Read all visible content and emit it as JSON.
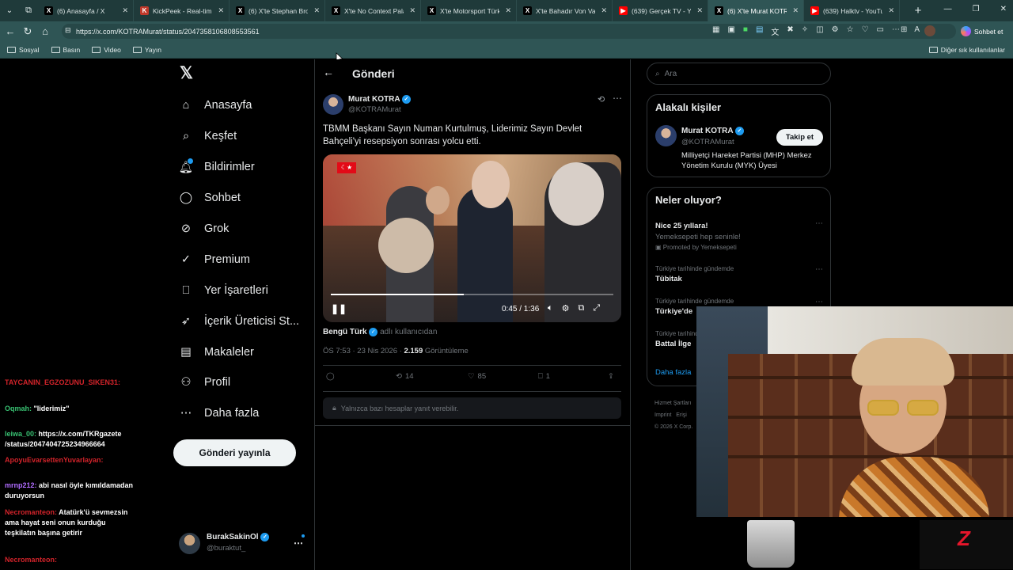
{
  "browser": {
    "tabs": [
      {
        "title": "(6) Anasayfa / X",
        "icon": "x-icon",
        "color": "#000000",
        "glyph": "X"
      },
      {
        "title": "KickPeek - Real-time UI",
        "icon": "kickpeek-icon",
        "color": "#c0392b",
        "glyph": "K"
      },
      {
        "title": "(6) X'te Stephan Brock",
        "icon": "x-icon",
        "color": "#000000",
        "glyph": "X"
      },
      {
        "title": "X'te No Context Pala: \"",
        "icon": "x-icon",
        "color": "#000000",
        "glyph": "X"
      },
      {
        "title": "X'te Motorsport Türkiye",
        "icon": "x-icon",
        "color": "#000000",
        "glyph": "X"
      },
      {
        "title": "X'te Bahadır Von Vanlı",
        "icon": "x-icon",
        "color": "#000000",
        "glyph": "X"
      },
      {
        "title": "(639) Gerçek TV - YouT",
        "icon": "youtube-icon",
        "color": "#ff0000",
        "glyph": "▶"
      },
      {
        "title": "(6) X'te Murat KOTR",
        "icon": "x-icon",
        "color": "#000000",
        "glyph": "X",
        "active": true
      },
      {
        "title": "(639) Halktv - YouTube",
        "icon": "youtube-icon",
        "color": "#ff0000",
        "glyph": "▶"
      }
    ],
    "url": "https://x.com/KOTRAMurat/status/2047358106808553561",
    "copilot_label": "Sohbet et",
    "bookmarks": [
      "Sosyal",
      "Basın",
      "Video",
      "Yayın"
    ],
    "other_bookmarks": "Diğer sık kullanılanlar"
  },
  "sidebar": {
    "items": [
      {
        "label": "Anasayfa",
        "icon": "home-icon"
      },
      {
        "label": "Keşfet",
        "icon": "search-icon"
      },
      {
        "label": "Bildirimler",
        "icon": "bell-icon"
      },
      {
        "label": "Sohbet",
        "icon": "chat-icon"
      },
      {
        "label": "Grok",
        "icon": "grok-icon"
      },
      {
        "label": "Premium",
        "icon": "premium-icon"
      },
      {
        "label": "Yer İşaretleri",
        "icon": "bookmark-icon"
      },
      {
        "label": "İçerik Üreticisi St...",
        "icon": "rocket-icon"
      },
      {
        "label": "Makaleler",
        "icon": "article-icon"
      },
      {
        "label": "Profil",
        "icon": "person-icon"
      },
      {
        "label": "Daha fazla",
        "icon": "more-circle-icon"
      }
    ],
    "post_button": "Gönderi yayınla",
    "account": {
      "name": "BurakSakinOl",
      "handle": "@buraktut_"
    }
  },
  "post": {
    "header_title": "Gönderi",
    "author_name": "Murat KOTRA",
    "author_handle": "@KOTRAMurat",
    "text": "TBMM Başkanı Sayın Numan Kurtulmuş, Liderimiz Sayın Devlet Bahçeli'yi resepsiyon sonrası yolcu etti.",
    "video_time": "0:45 / 1:36",
    "video_progress": 0.47,
    "source_name": "Bengü Türk",
    "source_suffix": "adlı kullanıcıdan",
    "timestamp": "ÖS 7:53 · 23 Nis 2026 ·",
    "views": "2.159",
    "views_label": "Görüntüleme",
    "retweets": "14",
    "likes": "85",
    "bookmarks": "1",
    "reply_restriction": "Yalnızca bazı hesaplar yanıt verebilir."
  },
  "right": {
    "search_placeholder": "Ara",
    "related_title": "Alakalı kişiler",
    "related": {
      "name": "Murat KOTRA",
      "handle": "@KOTRAMurat",
      "follow": "Takip et",
      "bio": "Milliyetçi Hareket Partisi (MHP) Merkez Yönetim Kurulu (MYK) Üyesi"
    },
    "trends_title": "Neler oluyor?",
    "trends": [
      {
        "title": "Nice 25 yıllara!",
        "sub": "Yemeksepeti hep seninle!",
        "promo": "Promoted by Yemeksepeti"
      },
      {
        "context": "Türkiye tarihinde gündemde",
        "title": "Tübitak"
      },
      {
        "context": "Türkiye tarihinde gündemde",
        "title": "Türkiye'de"
      },
      {
        "context": "Türkiye tarihinde gündemde",
        "title": "Battal İlge"
      }
    ],
    "more": "Daha fazla",
    "footer": [
      "Hizmet Şartları",
      "Imprint",
      "Erişi",
      "© 2026 X Corp."
    ]
  },
  "chat": [
    {
      "name": "TAYCANIN_EGZOZUNU_SIKEN31:",
      "name_color": "red",
      "msg": ""
    },
    {
      "name": "Oqmah:",
      "name_color": "green",
      "msg": " \"liderimiz\""
    },
    {
      "name": "leiwa_00:",
      "name_color": "green",
      "msg": " https://x.com/TKRgazete /status/2047404725234966664"
    },
    {
      "name": "ApoyuEvarsettenYuvarlayan:",
      "name_color": "red",
      "msg": ""
    },
    {
      "name": "mrnp212:",
      "name_color": "purple",
      "msg": " abi nasıl öyle kımıldamadan duruyorsun"
    },
    {
      "name": "Necromanteon:",
      "name_color": "red",
      "msg": " Atatürk'ü sevmezsin ama hayat seni onun kurduğu teşkilatın başına getirir"
    },
    {
      "name": "Necromanteon:",
      "name_color": "red",
      "msg": ""
    }
  ],
  "overlay": {
    "logo_glyph": "Z"
  },
  "colors": {
    "accent": "#1d9bf0",
    "chrome": "#2f5555",
    "tabbar": "#1f3a3a"
  }
}
